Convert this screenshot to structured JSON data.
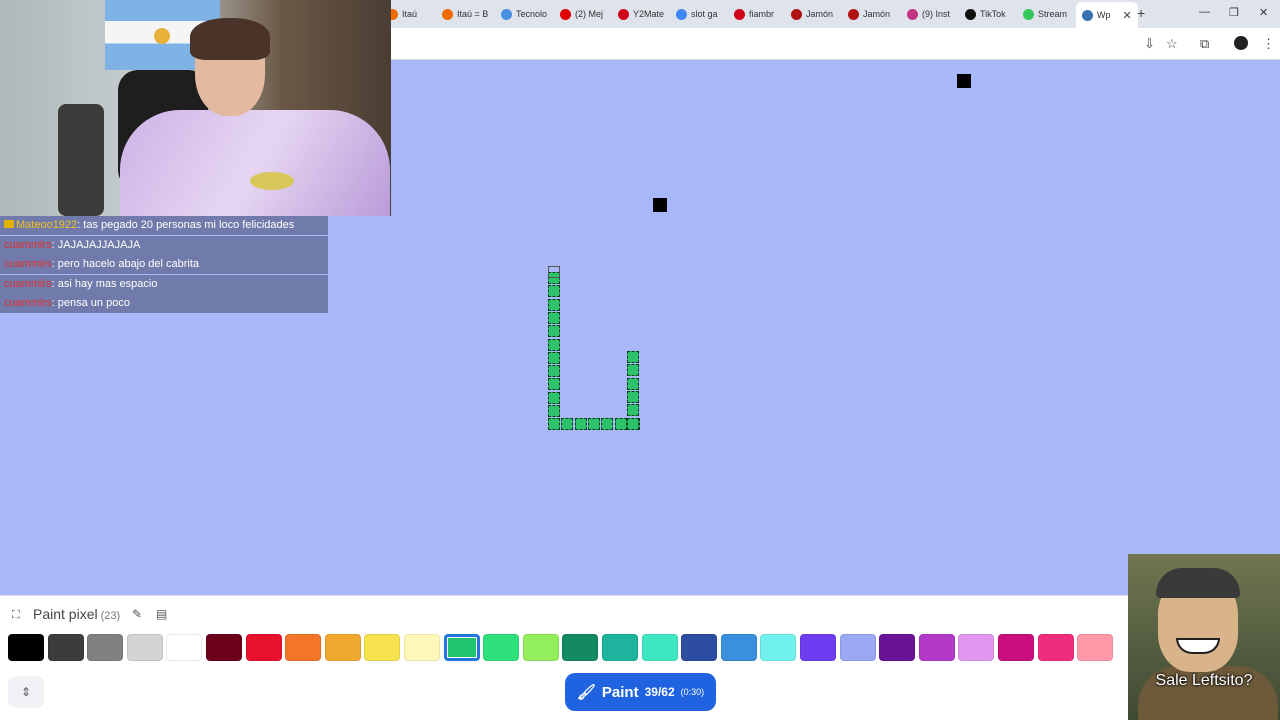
{
  "browser": {
    "tabs": [
      {
        "label": "Itaú",
        "color": "#f06a00"
      },
      {
        "label": "Itaú = B",
        "color": "#f06a00"
      },
      {
        "label": "Tecnolo",
        "color": "#4a90e2"
      },
      {
        "label": "(2) Mej",
        "color": "#e00000"
      },
      {
        "label": "Y2Mate",
        "color": "#d0021b"
      },
      {
        "label": "slot ga",
        "color": "#4285f4"
      },
      {
        "label": "fiambr",
        "color": "#d0021b"
      },
      {
        "label": "Jamón",
        "color": "#b01212"
      },
      {
        "label": "Jamón",
        "color": "#b01212"
      },
      {
        "label": "(9) Inst",
        "color": "#c13584"
      },
      {
        "label": "TikTok",
        "color": "#111111"
      },
      {
        "label": "Stream",
        "color": "#35c759"
      }
    ],
    "active_tab": {
      "label": "Wp",
      "close": "✕"
    },
    "new_tab": "+",
    "window_controls": [
      "—",
      "❐",
      "✕"
    ]
  },
  "chat": [
    {
      "user": "Mateoo1922",
      "user_color": "#f0c419",
      "badge": true,
      "message": ": tas pegado 20 personas mi loco felicidades"
    },
    {
      "user": "cuammirs",
      "user_color": "#e03030",
      "badge": false,
      "message": ": JAJAJAJJAJAJA"
    },
    {
      "user": "cuammirs",
      "user_color": "#e03030",
      "badge": false,
      "message": ": pero hacelo abajo del cabrita"
    },
    {
      "user": "cuammirs",
      "user_color": "#e03030",
      "badge": false,
      "message": ": asi hay mas espacio"
    },
    {
      "user": "cuammirs",
      "user_color": "#e03030",
      "badge": false,
      "message": ": pensa un poco"
    }
  ],
  "overlay_caption": "Sale Leftsito?",
  "panel": {
    "title": "Paint pixel",
    "count": "(23)",
    "palette": [
      "#000000",
      "#3c3c3c",
      "#808080",
      "#d4d4d4",
      "#ffffff",
      "#6d001a",
      "#e9112d",
      "#f37529",
      "#f0a82e",
      "#f6e24d",
      "#fff8b8",
      "#20c46e",
      "#2fe07a",
      "#93ee5b",
      "#148a60",
      "#1db39c",
      "#3be6c0",
      "#2d4ea0",
      "#3a90dd",
      "#71f1ed",
      "#6d3cf0",
      "#9aa8f2",
      "#6a1396",
      "#b33ac9",
      "#e097f0",
      "#c80f7d",
      "#f02d7d",
      "#ff99aa"
    ],
    "selected_index": 11,
    "paint_button": {
      "label": "Paint",
      "progress": "39/62",
      "timer": "(0:30)"
    }
  },
  "canvas": {
    "background": "#a8b8fb",
    "pixel_color": "#2ec26a"
  }
}
